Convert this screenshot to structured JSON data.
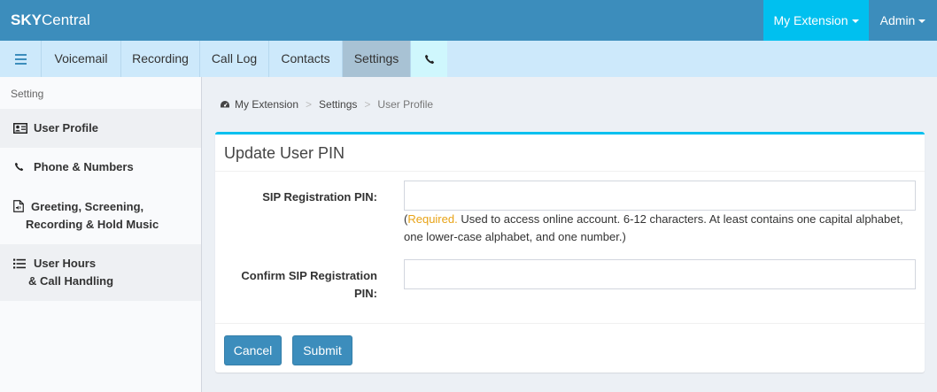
{
  "header": {
    "brand_bold": "SKY",
    "brand_rest": "Central",
    "extension_menu": "My Extension",
    "admin_menu": "Admin"
  },
  "nav": {
    "tabs": [
      {
        "label": "Voicemail"
      },
      {
        "label": "Recording"
      },
      {
        "label": "Call Log"
      },
      {
        "label": "Contacts"
      },
      {
        "label": "Settings"
      }
    ],
    "active": "Settings"
  },
  "sidebar": {
    "heading": "Setting",
    "items": [
      {
        "line1": "User Profile",
        "icon": "id-card-icon"
      },
      {
        "line1": "Phone & Numbers",
        "icon": "phone-icon"
      },
      {
        "line1": "Greeting, Screening,",
        "line2": "Recording & Hold Music",
        "icon": "audio-file-icon"
      },
      {
        "line1": "User Hours",
        "line2": "& Call Handling",
        "icon": "list-icon"
      }
    ]
  },
  "breadcrumb": {
    "home": "My Extension",
    "middle": "Settings",
    "current": "User Profile",
    "separator": ">"
  },
  "form": {
    "title": "Update User PIN",
    "pin_label": "SIP Registration PIN:",
    "pin_value": "",
    "help_open": "(",
    "help_required": "Required.",
    "help_text": " Used to access online account. 6-12 characters. At least contains one capital alphabet, one lower-case alphabet, and one number.)",
    "confirm_label_line1": "Confirm SIP Registration",
    "confirm_label_line2": "PIN:",
    "confirm_value": "",
    "cancel_label": "Cancel",
    "submit_label": "Submit"
  },
  "colors": {
    "header": "#3c8dbc",
    "extension_bg": "#00c0ef",
    "navbar": "#cde9fb",
    "required": "#e8a317"
  }
}
